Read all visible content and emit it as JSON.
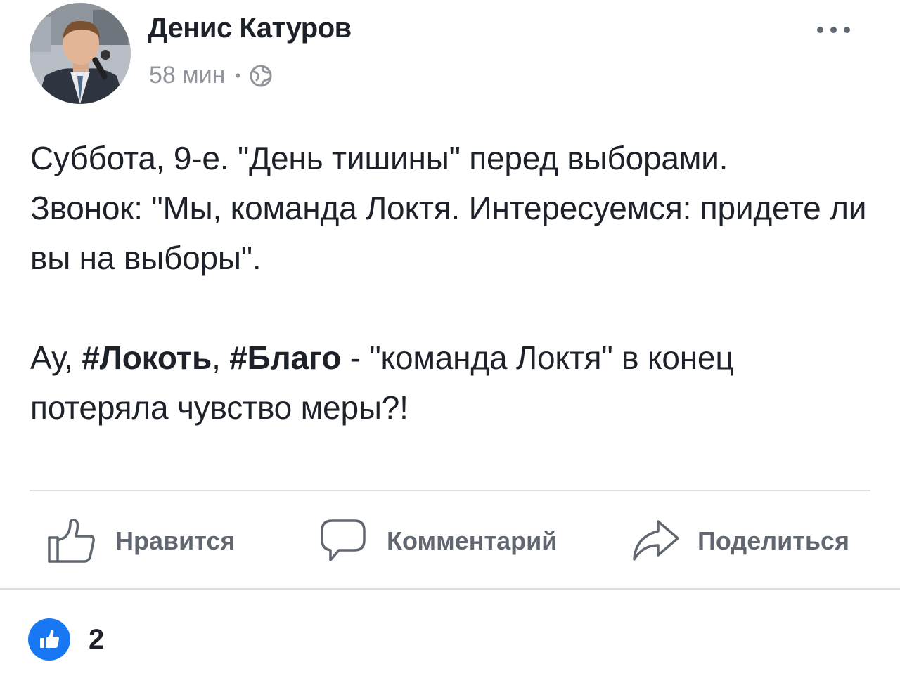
{
  "author": {
    "name": "Денис Катуров",
    "time": "58 мин",
    "separator": "•",
    "privacy_icon": "globe-icon",
    "avatar_icon": "profile-photo"
  },
  "menu": {
    "more_icon": "more-options-icon"
  },
  "post": {
    "line1": "Суббота, 9-е. \"День тишины\" перед выборами.",
    "line2": "Звонок: \"Мы, команда Локтя. Интересуемся: придете ли вы на выборы\".",
    "line3_prefix": "Ау, ",
    "hashtag1": "#Локоть",
    "comma": ", ",
    "hashtag2": "#Благо",
    "line3_suffix": " - \"команда Локтя\" в конец потеряла чувство меры?!"
  },
  "actions": {
    "like_label": "Нравится",
    "comment_label": "Комментарий",
    "share_label": "Поделиться",
    "like_icon": "thumbs-up-icon",
    "comment_icon": "speech-bubble-icon",
    "share_icon": "share-arrow-icon"
  },
  "reactions": {
    "count": "2",
    "icon": "like-reaction-icon"
  },
  "colors": {
    "text": "#1d2129",
    "secondary": "#90949c",
    "action": "#606770",
    "accent": "#1877f2",
    "divider": "#dadde1"
  }
}
